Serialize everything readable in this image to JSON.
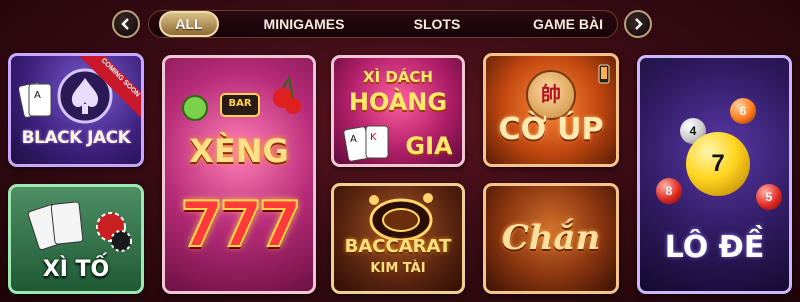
{
  "nav": {
    "prev_icon": "chevron-left-icon",
    "next_icon": "chevron-right-icon"
  },
  "tabs": [
    {
      "label": "ALL",
      "active": true
    },
    {
      "label": "MINIGAMES",
      "active": false
    },
    {
      "label": "SLOTS",
      "active": false
    },
    {
      "label": "GAME BÀI",
      "active": false
    }
  ],
  "games": {
    "blackjack": {
      "title": "BLACK JACK",
      "ribbon": "COMING SOON"
    },
    "xito": {
      "title": "XÌ TỐ"
    },
    "xeng": {
      "title": "XÈNG",
      "number": "777",
      "badge": "BAR"
    },
    "xidach": {
      "line1": "XÌ DÁCH",
      "line2": "HOÀNG",
      "line3": "GIA"
    },
    "baccarat": {
      "line1": "BACCARAT",
      "line2": "KIM TÀI"
    },
    "coup": {
      "title": "CỜ ÚP",
      "piece": "帥"
    },
    "chan": {
      "title": "Chắn"
    },
    "lode": {
      "title": "LÔ ĐỀ",
      "big_ball": "7",
      "balls": [
        "6",
        "4",
        "8",
        "5"
      ]
    }
  },
  "colors": {
    "background": "#3a0c14",
    "tab_active": "#c8a86a",
    "ribbon": "#c8182a"
  }
}
